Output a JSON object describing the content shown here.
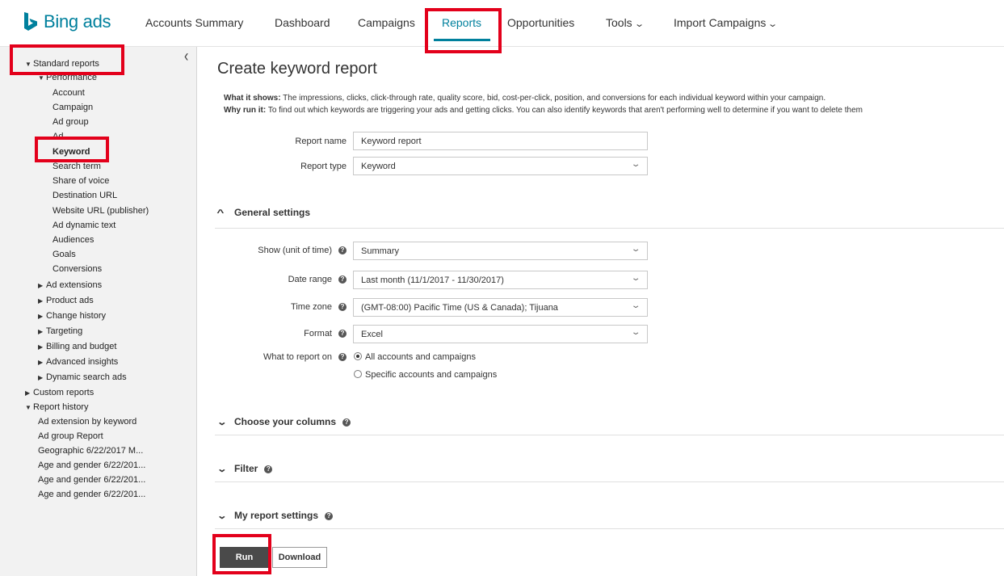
{
  "brand": {
    "name": "Bing ads",
    "color": "#00809d"
  },
  "nav": {
    "items": [
      "Accounts Summary",
      "Dashboard",
      "Campaigns",
      "Reports",
      "Opportunities",
      "Tools",
      "Import Campaigns"
    ],
    "active": "Reports"
  },
  "sidebar": {
    "collapse_icon": "chevron-left-icon",
    "standard_reports": "Standard reports",
    "performance": "Performance",
    "performance_items": [
      "Account",
      "Campaign",
      "Ad group",
      "Ad",
      "Keyword",
      "Search term",
      "Share of voice",
      "Destination URL",
      "Website URL (publisher)",
      "Ad dynamic text",
      "Audiences",
      "Goals",
      "Conversions"
    ],
    "selected": "Keyword",
    "groups": [
      "Ad extensions",
      "Product ads",
      "Change history",
      "Targeting",
      "Billing and budget",
      "Advanced insights",
      "Dynamic search ads"
    ],
    "custom_reports": "Custom reports",
    "report_history": "Report history",
    "history_items": [
      "Ad extension by keyword",
      "Ad group Report",
      "Geographic 6/22/2017 M...",
      "Age and gender 6/22/201...",
      "Age and gender 6/22/201...",
      "Age and gender 6/22/201..."
    ]
  },
  "main": {
    "title": "Create keyword report",
    "what_label": "What it shows:",
    "what_text": " The impressions, clicks, click-through rate, quality score, bid, cost-per-click, position, and conversions for each individual keyword within your campaign.",
    "why_label": "Why run it:",
    "why_text": " To find out which keywords are triggering your ads and getting clicks. You can also identify keywords that aren't performing well to determine if you want to delete them",
    "report_name_label": "Report name",
    "report_name_value": "Keyword report",
    "report_type_label": "Report type",
    "report_type_value": "Keyword",
    "general_settings": "General settings",
    "show_label": "Show (unit of time)",
    "show_value": "Summary",
    "date_range_label": "Date range",
    "date_range_value": "Last month (11/1/2017 - 11/30/2017)",
    "time_zone_label": "Time zone",
    "time_zone_value": "(GMT-08:00) Pacific Time (US & Canada); Tijuana",
    "format_label": "Format",
    "format_value": "Excel",
    "report_on_label": "What to report on",
    "report_on_options": [
      "All accounts and campaigns",
      "Specific accounts and campaigns"
    ],
    "report_on_selected": "All accounts and campaigns",
    "choose_columns": "Choose your columns",
    "filter": "Filter",
    "my_report_settings": "My report settings",
    "run": "Run",
    "download": "Download"
  },
  "highlight_color": "#e3001b"
}
